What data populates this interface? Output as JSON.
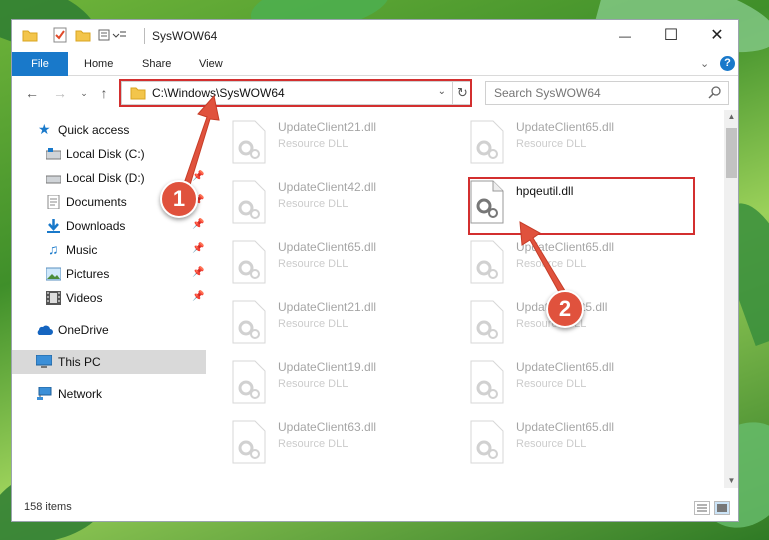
{
  "window": {
    "title": "SysWOW64",
    "controls": {
      "minimize": "—",
      "maximize": "☐",
      "close": "✕"
    }
  },
  "ribbon": {
    "tabs": [
      "File",
      "Home",
      "Share",
      "View"
    ]
  },
  "address": {
    "path": "C:\\Windows\\SysWOW64"
  },
  "search": {
    "placeholder": "Search SysWOW64"
  },
  "sidebar": {
    "items": [
      {
        "label": "Quick access",
        "icon": "star-icon",
        "pinned": false
      },
      {
        "label": "Local Disk (C:)",
        "icon": "drive-icon",
        "pinned": false
      },
      {
        "label": "Local Disk (D:)",
        "icon": "drive-icon",
        "pinned": true
      },
      {
        "label": "Documents",
        "icon": "documents-icon",
        "pinned": true
      },
      {
        "label": "Downloads",
        "icon": "downloads-icon",
        "pinned": true
      },
      {
        "label": "Music",
        "icon": "music-icon",
        "pinned": true
      },
      {
        "label": "Pictures",
        "icon": "pictures-icon",
        "pinned": true
      },
      {
        "label": "Videos",
        "icon": "videos-icon",
        "pinned": true
      },
      {
        "label": "OneDrive",
        "icon": "cloud-icon",
        "pinned": false
      },
      {
        "label": "This PC",
        "icon": "computer-icon",
        "pinned": false
      },
      {
        "label": "Network",
        "icon": "network-icon",
        "pinned": false
      }
    ]
  },
  "files": {
    "left_column": [
      {
        "name": "UpdateClient21.dll",
        "type": "Resource DLL"
      },
      {
        "name": "UpdateClient42.dll",
        "type": "Resource DLL"
      },
      {
        "name": "UpdateClient65.dll",
        "type": "Resource DLL"
      },
      {
        "name": "UpdateClient21.dll",
        "type": "Resource DLL"
      },
      {
        "name": "UpdateClient19.dll",
        "type": "Resource DLL"
      },
      {
        "name": "UpdateClient63.dll",
        "type": "Resource DLL"
      }
    ],
    "right_column": [
      {
        "name": "UpdateClient65.dll",
        "type": "Resource DLL"
      },
      {
        "name": "hpqeutil.dll",
        "type": ""
      },
      {
        "name": "UpdateClient65.dll",
        "type": "Resource DLL"
      },
      {
        "name": "UpdateClient5.dll",
        "type": "Resource DLL"
      },
      {
        "name": "UpdateClient65.dll",
        "type": "Resource DLL"
      },
      {
        "name": "UpdateClient65.dll",
        "type": "Resource DLL"
      }
    ]
  },
  "status": {
    "item_count": "158 items"
  },
  "callouts": [
    "1",
    "2"
  ],
  "colors": {
    "accent": "#1979ca",
    "highlight": "#d32f2f",
    "callout": "#e0523d"
  }
}
